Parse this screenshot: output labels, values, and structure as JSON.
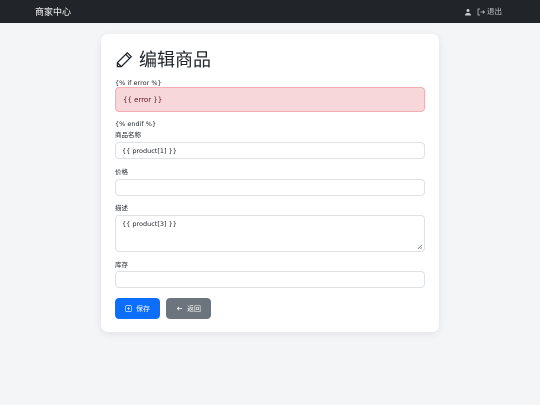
{
  "navbar": {
    "brand": "商家中心",
    "user_icon": "user-icon",
    "logout_icon": "logout-icon",
    "logout_label": "退出"
  },
  "card": {
    "title_icon": "pencil-icon",
    "title": "编辑商品",
    "if_error": "{% if error %}",
    "error_text": "{{ error }}",
    "endif": "{% endif %}",
    "fields": [
      {
        "label": "商品名称",
        "value": "{{ product[1] }}"
      },
      {
        "label": "价格",
        "value": ""
      },
      {
        "label": "描述",
        "value": "{{ product[3] }}"
      },
      {
        "label": "库存",
        "value": ""
      }
    ],
    "save_icon": "save-icon",
    "save_label": "保存",
    "back_icon": "arrow-left-icon",
    "back_label": "返回"
  },
  "colors": {
    "navbar_bg": "#212529",
    "primary": "#0d6efd",
    "secondary": "#6c757d",
    "alert_bg": "#f8d7da"
  }
}
